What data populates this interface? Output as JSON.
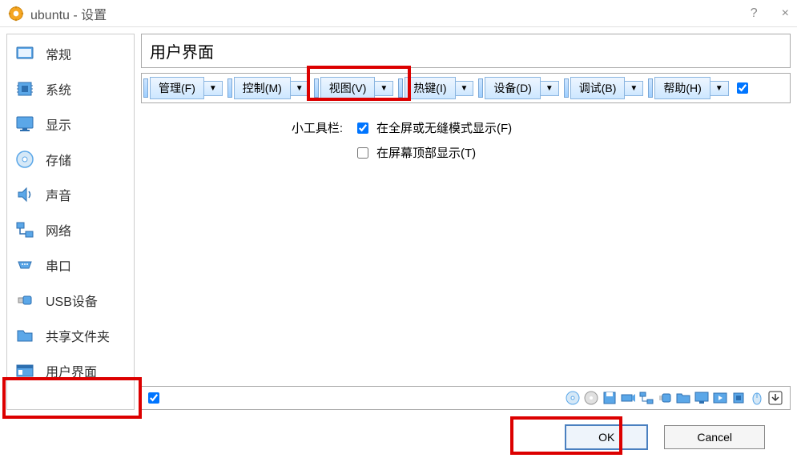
{
  "titlebar": {
    "title": "ubuntu - 设置",
    "help": "?",
    "close": "×"
  },
  "sidebar": {
    "items": [
      {
        "label": "常规",
        "key": "general"
      },
      {
        "label": "系统",
        "key": "system"
      },
      {
        "label": "显示",
        "key": "display"
      },
      {
        "label": "存储",
        "key": "storage"
      },
      {
        "label": "声音",
        "key": "audio"
      },
      {
        "label": "网络",
        "key": "network"
      },
      {
        "label": "串口",
        "key": "serial"
      },
      {
        "label": "USB设备",
        "key": "usb"
      },
      {
        "label": "共享文件夹",
        "key": "shared-folders"
      },
      {
        "label": "用户界面",
        "key": "user-interface"
      }
    ]
  },
  "main": {
    "header": "用户界面",
    "toolbar": {
      "items": [
        {
          "label": "管理(F)"
        },
        {
          "label": "控制(M)"
        },
        {
          "label": "视图(V)"
        },
        {
          "label": "热键(I)"
        },
        {
          "label": "设备(D)"
        },
        {
          "label": "调试(B)"
        },
        {
          "label": "帮助(H)"
        }
      ],
      "enabled": true
    },
    "options": {
      "label": "小工具栏:",
      "fullscreen": {
        "label": "在全屏或无缝模式显示(F)",
        "checked": true
      },
      "top": {
        "label": "在屏幕顶部显示(T)",
        "checked": false
      }
    },
    "status_icons": [
      "disk",
      "optical",
      "floppy",
      "recorder",
      "network",
      "usb-s",
      "folder",
      "display-s",
      "video",
      "chip",
      "mouse",
      "download"
    ]
  },
  "footer": {
    "ok": "OK",
    "cancel": "Cancel"
  }
}
